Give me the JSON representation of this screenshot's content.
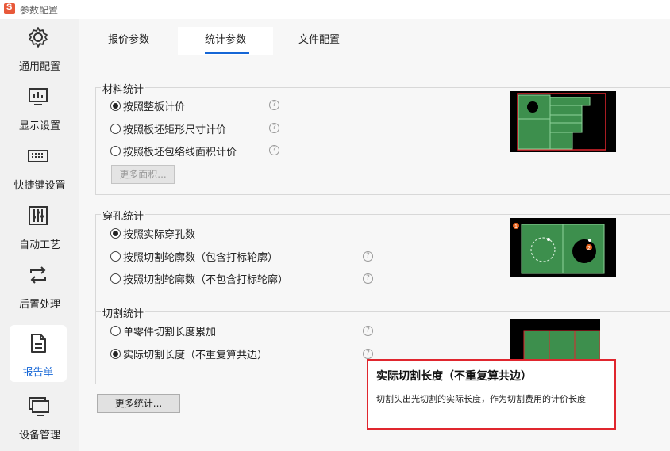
{
  "window": {
    "title": "参数配置"
  },
  "sidebar": {
    "items": [
      {
        "label": "通用配置",
        "icon": "gear-icon"
      },
      {
        "label": "显示设置",
        "icon": "display-icon"
      },
      {
        "label": "快捷键设置",
        "icon": "keyboard-icon"
      },
      {
        "label": "自动工艺",
        "icon": "sliders-icon"
      },
      {
        "label": "后置处理",
        "icon": "loop-arrows-icon"
      },
      {
        "label": "报告单",
        "icon": "document-icon",
        "active": true
      },
      {
        "label": "设备管理",
        "icon": "monitor-icon"
      }
    ]
  },
  "tabs": [
    {
      "label": "报价参数"
    },
    {
      "label": "统计参数",
      "active": true
    },
    {
      "label": "文件配置"
    }
  ],
  "material": {
    "title": "材料统计",
    "options": [
      {
        "label": "按照整板计价",
        "checked": true
      },
      {
        "label": "按照板坯矩形尺寸计价",
        "checked": false
      },
      {
        "label": "按照板坯包络线面积计价",
        "checked": false
      }
    ],
    "more_button": "更多面积..."
  },
  "piercing": {
    "title": "穿孔统计",
    "options": [
      {
        "label": "按照实际穿孔数",
        "checked": true
      },
      {
        "label": "按照切割轮廓数（包含打标轮廓）",
        "checked": false
      },
      {
        "label": "按照切割轮廓数（不包含打标轮廓）",
        "checked": false
      }
    ],
    "markers": [
      "1",
      "2"
    ]
  },
  "cutting": {
    "title": "切割统计",
    "options": [
      {
        "label": "单零件切割长度累加",
        "checked": false
      },
      {
        "label": "实际切割长度（不重复算共边）",
        "checked": true
      }
    ]
  },
  "more_stats_button": "更多统计...",
  "help_glyph": "?",
  "tooltip": {
    "title": "实际切割长度（不重复算共边）",
    "body": "切割头出光切割的实际长度，作为切割费用的计价长度"
  },
  "colors": {
    "accent": "#1566d6",
    "tooltip_border": "#e0262e",
    "part_green": "#3d8f4d",
    "marker_orange": "#e8621a"
  }
}
